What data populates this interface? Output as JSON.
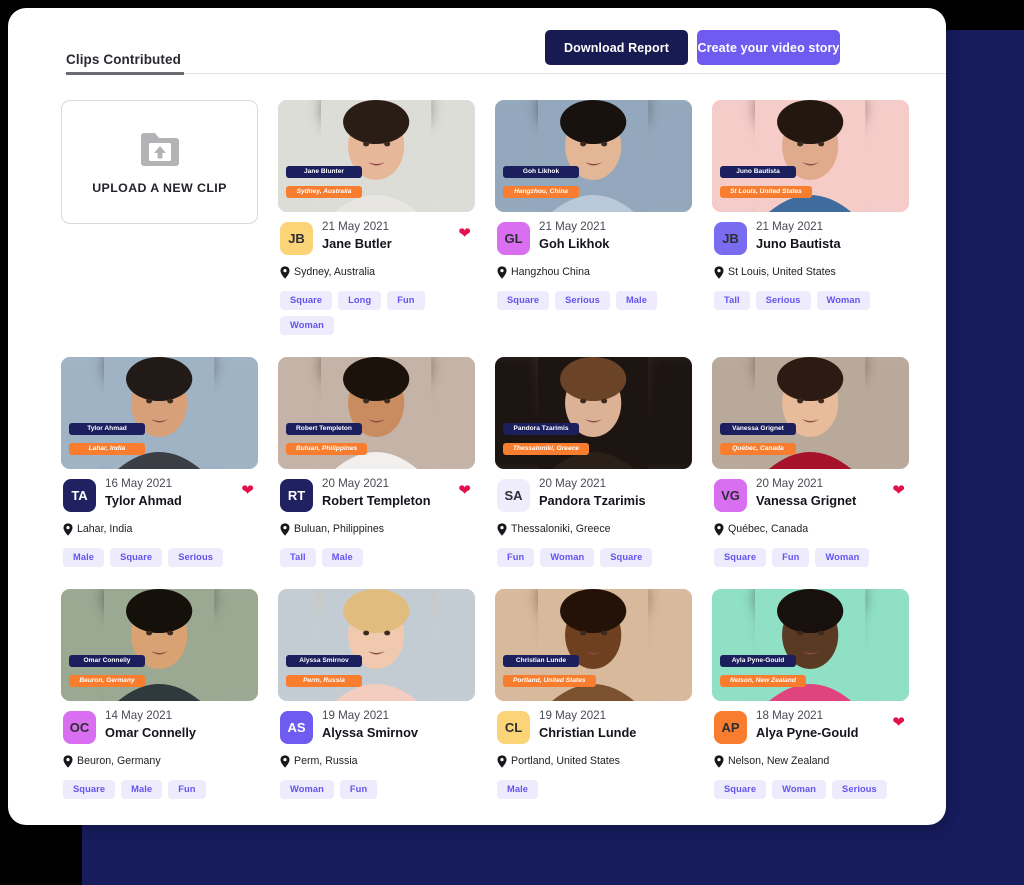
{
  "header": {
    "tab_label": "Clips Contributed",
    "download_button": "Download Report",
    "create_button": "Create your video story"
  },
  "upload": {
    "label": "UPLOAD A NEW CLIP",
    "icon": "folder-upload-icon"
  },
  "icons": {
    "pin": "location-pin-icon",
    "heart": "heart-icon"
  },
  "colors": {
    "backdrop_navy": "#161c5c",
    "button_dark": "#171b52",
    "button_purple": "#6f5bf0",
    "overlay_name": "#1b1f5e",
    "overlay_location": "#f97d2e",
    "tag_bg": "#eeebfd",
    "tag_text": "#6454ef",
    "heart": "#e2114c"
  },
  "clips": [
    {
      "initials": "JB",
      "avatar_color": "#fbd477",
      "date": "21 May 2021",
      "name": "Jane Butler",
      "location": "Sydney, Australia",
      "overlay_name": "Jane Blunter",
      "overlay_location": "Sydney, Australia",
      "favorite": true,
      "tags": [
        "Square",
        "Long",
        "Fun",
        "Woman"
      ],
      "photo": {
        "bg": "#ddddd8",
        "skin": "#e7b79a",
        "hair": "#2a1d16",
        "cloth": "#e8e6e2"
      }
    },
    {
      "initials": "GL",
      "avatar_color": "#d96ef0",
      "date": "21 May 2021",
      "name": "Goh Likhok",
      "location": "Hangzhou China",
      "overlay_name": "Goh Likhok",
      "overlay_location": "Hangzhou, China",
      "favorite": false,
      "tags": [
        "Square",
        "Serious",
        "Male"
      ],
      "photo": {
        "bg": "#93a8bc",
        "skin": "#e3b696",
        "hair": "#18120e",
        "cloth": "#b9c9d9"
      }
    },
    {
      "initials": "JB",
      "avatar_color": "#7a6cf0",
      "date": "21 May 2021",
      "name": "Juno Bautista",
      "location": "St Louis, United States",
      "overlay_name": "Juno Bautista",
      "overlay_location": "St Louis, United States",
      "favorite": false,
      "tags": [
        "Tall",
        "Serious",
        "Woman"
      ],
      "photo": {
        "bg": "#f6ccc9",
        "skin": "#e0aa8d",
        "hair": "#231710",
        "cloth": "#3f6c9c"
      }
    },
    {
      "initials": "TA",
      "avatar_color": "#1f2160",
      "avatar_text_color": "#ffffff",
      "date": "16 May 2021",
      "name": "Tylor Ahmad",
      "location": "Lahar, India",
      "overlay_name": "Tylor Ahmad",
      "overlay_location": "Lahar, India",
      "favorite": true,
      "tags": [
        "Male",
        "Square",
        "Serious"
      ],
      "photo": {
        "bg": "#9fb3c4",
        "skin": "#d7a078",
        "hair": "#211a16",
        "cloth": "#3b3f45"
      }
    },
    {
      "initials": "RT",
      "avatar_color": "#1f2160",
      "avatar_text_color": "#ffffff",
      "date": "20 May 2021",
      "name": "Robert Templeton",
      "location": "Buluan, Philippines",
      "overlay_name": "Robert Templeton",
      "overlay_location": "Buluan, Philippines",
      "favorite": true,
      "tags": [
        "Tall",
        "Male"
      ],
      "photo": {
        "bg": "#c4b3a6",
        "skin": "#c98c60",
        "hair": "#1b120c",
        "cloth": "#f2f0ee"
      }
    },
    {
      "initials": "SA",
      "avatar_color": "#efedfb",
      "date": "20 May 2021",
      "name": "Pandora Tzarimis",
      "location": "Thessaloniki, Greece",
      "overlay_name": "Pandora Tzarimis",
      "overlay_location": "Thessaloniki, Greece",
      "favorite": false,
      "tags": [
        "Fun",
        "Woman",
        "Square"
      ],
      "photo": {
        "bg": "#1d1512",
        "skin": "#dcb296",
        "hair": "#6b4428",
        "cloth": "#2a2018"
      }
    },
    {
      "initials": "VG",
      "avatar_color": "#d96ef0",
      "date": "20 May 2021",
      "name": "Vanessa Grignet",
      "location": "Québec, Canada",
      "overlay_name": "Vanessa Grignet",
      "overlay_location": "Québec, Canada",
      "favorite": true,
      "tags": [
        "Square",
        "Fun",
        "Woman"
      ],
      "photo": {
        "bg": "#b9a99b",
        "skin": "#e8bb9a",
        "hair": "#2c1b12",
        "cloth": "#a5122a"
      }
    },
    {
      "initials": "OC",
      "avatar_color": "#d96ef0",
      "date": "14 May 2021",
      "name": "Omar Connelly",
      "location": "Beuron, Germany",
      "overlay_name": "Omar Connelly",
      "overlay_location": "Beuron, Germany",
      "favorite": false,
      "tags": [
        "Square",
        "Male",
        "Fun"
      ],
      "photo": {
        "bg": "#9ba892",
        "skin": "#d9a273",
        "hair": "#16100b",
        "cloth": "#2f3a3c"
      }
    },
    {
      "initials": "AS",
      "avatar_color": "#6f5bf0",
      "avatar_text_color": "#ffffff",
      "date": "19 May 2021",
      "name": "Alyssa Smirnov",
      "location": "Perm, Russia",
      "overlay_name": "Alyssa Smirnov",
      "overlay_location": "Perm, Russia",
      "favorite": false,
      "tags": [
        "Woman",
        "Fun"
      ],
      "photo": {
        "bg": "#c4ccd3",
        "skin": "#f0c9ae",
        "hair": "#e0bd7f",
        "cloth": "#f3cdbf"
      }
    },
    {
      "initials": "CL",
      "avatar_color": "#fbd477",
      "date": "19 May 2021",
      "name": "Christian Lunde",
      "location": "Portland, United States",
      "overlay_name": "Christian Lunde",
      "overlay_location": "Portland, United States",
      "favorite": false,
      "tags": [
        "Male"
      ],
      "photo": {
        "bg": "#d9b99c",
        "skin": "#6e401f",
        "hair": "#241208",
        "cloth": "#7a5230"
      }
    },
    {
      "initials": "AP",
      "avatar_color": "#f97d2e",
      "date": "18 May 2021",
      "name": "Alya Pyne-Gould",
      "location": "Nelson, New Zealand",
      "overlay_name": "Ayla Pyne-Gould",
      "overlay_location": "Nelson, New Zealand",
      "favorite": true,
      "tags": [
        "Square",
        "Woman",
        "Serious"
      ],
      "photo": {
        "bg": "#8fe0c4",
        "skin": "#5b3a23",
        "hair": "#17100c",
        "cloth": "#e0447f"
      }
    }
  ]
}
